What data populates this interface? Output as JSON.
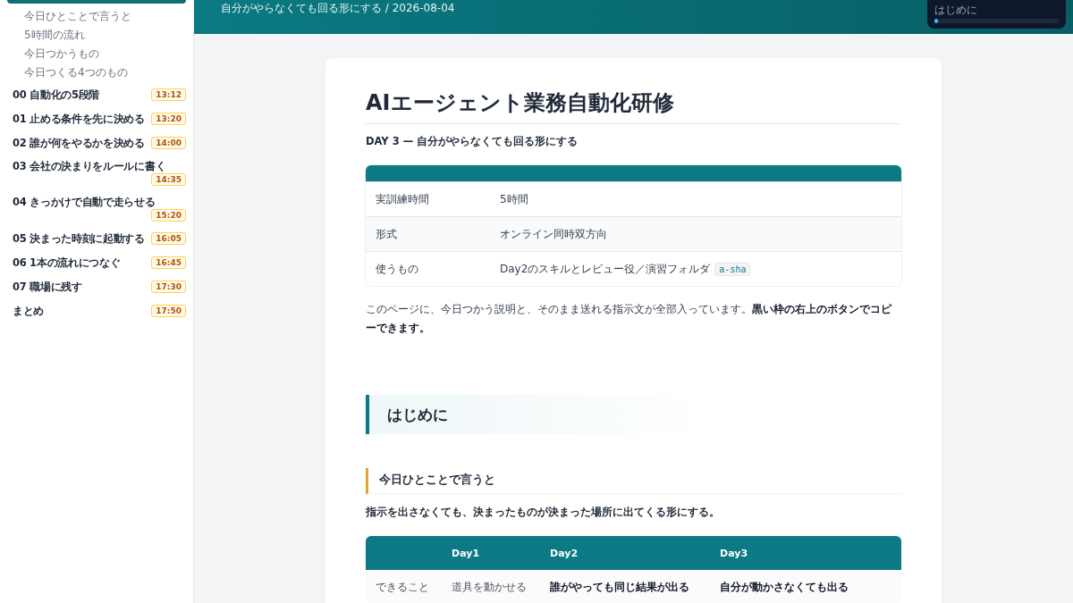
{
  "sidebar": {
    "sub_items": [
      {
        "label": "今日ひとことで言うと"
      },
      {
        "label": "5時間の流れ"
      },
      {
        "label": "今日つかうもの"
      },
      {
        "label": "今日つくる4つのもの"
      }
    ],
    "items": [
      {
        "label": "00 自動化の5段階",
        "time": "13:12"
      },
      {
        "label": "01 止める条件を先に決める",
        "time": "13:20"
      },
      {
        "label": "02 誰が何をやるかを決める",
        "time": "14:00"
      },
      {
        "label": "03 会社の決まりをルールに書く",
        "time": "14:35"
      },
      {
        "label": "04 きっかけで自動で走らせる",
        "time": "15:20"
      },
      {
        "label": "05 決まった時刻に起動する",
        "time": "16:05"
      },
      {
        "label": "06 1本の流れにつなぐ",
        "time": "16:45"
      },
      {
        "label": "07 職場に残す",
        "time": "17:30"
      },
      {
        "label": "まとめ",
        "time": "17:50"
      }
    ]
  },
  "header": {
    "subtitle": "自分がやらなくても回る形にする / 2026-08-04"
  },
  "progress_widget": {
    "label": "はじめに",
    "level": 0.03
  },
  "article": {
    "title": "AIエージェント業務自動化研修",
    "lead": "DAY 3 — 自分がやらなくても回る形にする",
    "info_rows": [
      {
        "label": "実訓練時間",
        "value": "5時間"
      },
      {
        "label": "形式",
        "value": "オンライン同時双方向"
      },
      {
        "label": "使うもの",
        "value": "Day2のスキルとレビュー役／演習フォルダ",
        "code": "a-sha"
      }
    ],
    "intro": "このページに、今日つかう説明と、そのまま送れる指示文が全部入っています。**黒い枠の右上のボタンでコピーできます。**",
    "section_title": "はじめに",
    "subsection_title": "今日ひとことで言うと",
    "summary": "指示を出さなくても、決まったものが決まった場所に出てくる形にする。",
    "compare_table": {
      "columns": [
        "Day1",
        "Day2",
        "Day3"
      ],
      "rows": [
        {
          "label": "できること",
          "cells": [
            {
              "text": "道具を動かせる",
              "bold": false
            },
            {
              "text": "誰がやっても同じ結果が出る",
              "bold": true
            },
            {
              "text": "自分が動かさなくても出る",
              "bold": true
            }
          ]
        }
      ]
    }
  }
}
